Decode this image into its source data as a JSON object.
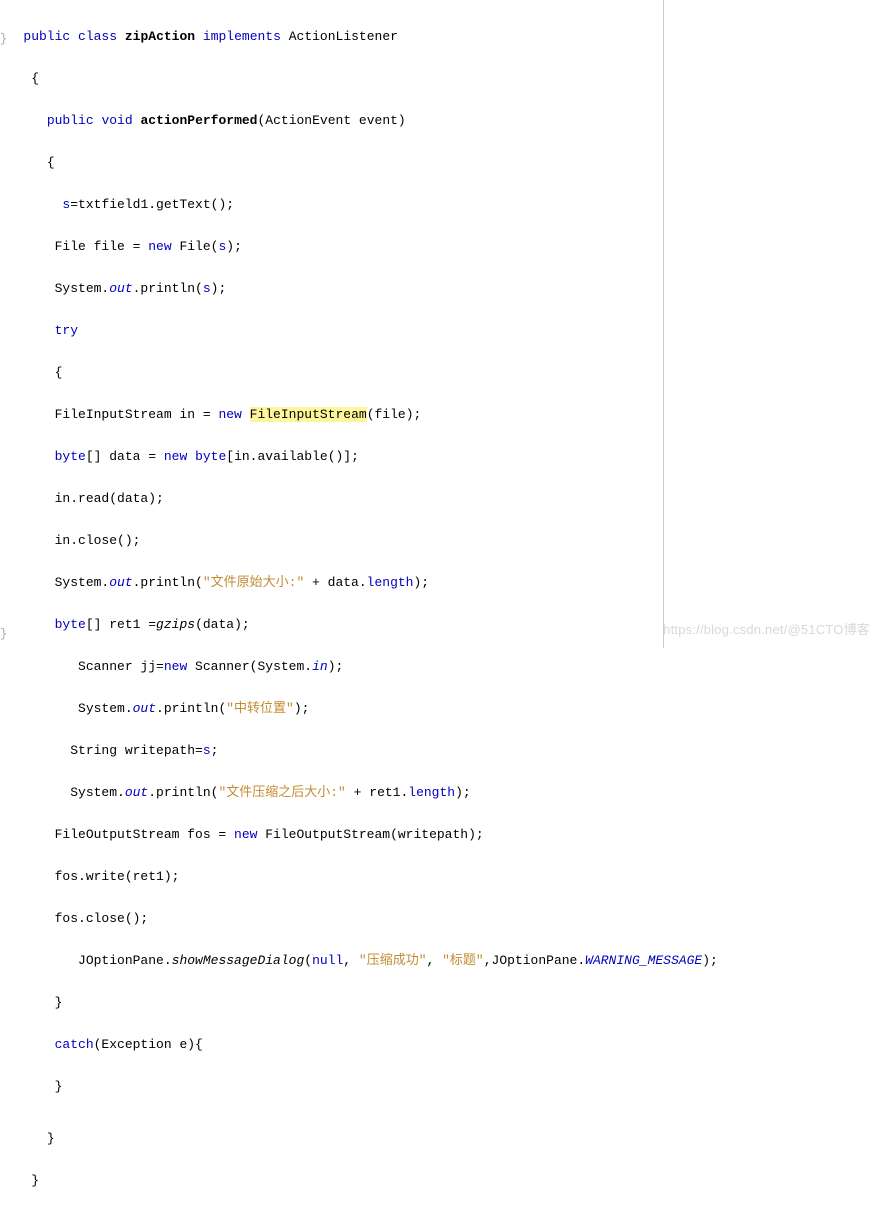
{
  "code": {
    "l1": {
      "kw1": "public",
      "kw2": "class",
      "name": "zipAction",
      "kw3": "implements",
      "iface": "ActionListener"
    },
    "l2": {
      "brace": "{"
    },
    "l3": {
      "kw1": "public",
      "kw2": "void",
      "name": "actionPerformed",
      "sig": "(ActionEvent event)"
    },
    "l4": {
      "brace": "{"
    },
    "l5": {
      "lhs": "s",
      "rhs": "=txtfield1.getText();"
    },
    "l6": {
      "a": "File file = ",
      "kw": "new",
      "b": " File(",
      "f": "s",
      "c": ");"
    },
    "l7": {
      "a": "System.",
      "out": "out",
      "b": ".println(",
      "f": "s",
      "c": ");"
    },
    "l8": {
      "kw": "try"
    },
    "l9": {
      "brace": "{"
    },
    "l10": {
      "a": "FileInputStream in = ",
      "kw": "new",
      "sp": " ",
      "hl": "FileInputStream",
      "b": "(file);"
    },
    "l11": {
      "kw1": "byte",
      "a": "[] data = ",
      "kw2": "new",
      "b": " ",
      "kw3": "byte",
      "c": "[in.available()];"
    },
    "l12": {
      "a": "in.read(data);"
    },
    "l13": {
      "a": "in.close();"
    },
    "l14": {
      "a": "System.",
      "out": "out",
      "b": ".println(",
      "str": "\"文件原始大小:\"",
      "c": " + data.",
      "fld": "length",
      "d": ");"
    },
    "l15": {
      "kw": "byte",
      "a": "[] ret1 =",
      "m": "gzips",
      "b": "(data);"
    },
    "l16": {
      "a": "Scanner jj=",
      "kw": "new",
      "b": " Scanner(System.",
      "in": "in",
      "c": ");"
    },
    "l17": {
      "a": "System.",
      "out": "out",
      "b": ".println(",
      "str": "\"中转位置\"",
      "c": ");"
    },
    "l18": {
      "a": "String writepath=",
      "f": "s",
      "b": ";"
    },
    "l19": {
      "a": "System.",
      "out": "out",
      "b": ".println(",
      "str": "\"文件压缩之后大小:\"",
      "c": " + ret1.",
      "fld": "length",
      "d": ");"
    },
    "l20": {
      "a": "FileOutputStream fos = ",
      "kw": "new",
      "b": " FileOutputStream(writepath);"
    },
    "l21": {
      "a": "fos.write(ret1);"
    },
    "l22": {
      "a": "fos.close();"
    },
    "l23": {
      "a": "JOptionPane.",
      "m": "showMessageDialog",
      "b": "(",
      "kw": "null",
      "c": ", ",
      "s1": "\"压缩成功\"",
      "d": ", ",
      "s2": "\"标题\"",
      "e": ",JOptionPane.",
      "wm": "WARNING_MESSAGE",
      "f": ");"
    },
    "l24": {
      "brace": "}"
    },
    "l25": {
      "kw": "catch",
      "a": "(Exception e){"
    },
    "l26": {
      "brace": "}"
    },
    "l27": {
      "brace": "}"
    },
    "l28": {
      "brace": "}"
    }
  },
  "gutter": {
    "mark1": "}",
    "mark2": "}"
  },
  "watermark": "https://blog.csdn.net/@51CTO博客"
}
